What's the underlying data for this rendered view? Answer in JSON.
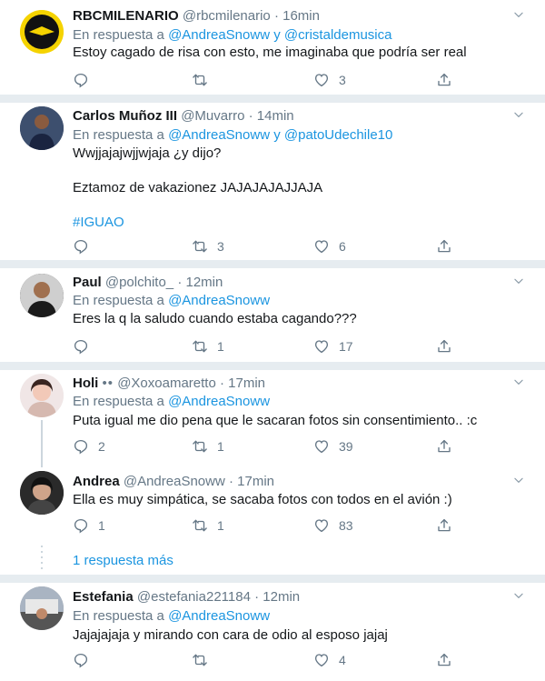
{
  "reply_prefix": "En respuesta a",
  "and_word": "y",
  "dot": "·",
  "tweets": [
    {
      "name": "RBCMILENARIO",
      "handle": "@rbcmilenario",
      "time": "16min",
      "mentions": [
        "@AndreaSnoww",
        "@cristaldemusica"
      ],
      "lines": [
        "Estoy cagado de risa con esto, me imaginaba que podría ser real"
      ],
      "replies": "",
      "retweets": "",
      "likes": "3"
    },
    {
      "name": "Carlos Muñoz III",
      "handle": "@Muvarro",
      "time": "14min",
      "mentions": [
        "@AndreaSnoww",
        "@patoUdechile10"
      ],
      "lines": [
        "Wwjjajajwjjwjaja ¿y dijo?",
        "Eztamoz de vakazionez JAJAJAJAJJAJA",
        "#IGUAO"
      ],
      "replies": "",
      "retweets": "3",
      "likes": "6"
    },
    {
      "name": "Paul",
      "handle": "@polchito_",
      "time": "12min",
      "mentions": [
        "@AndreaSnoww"
      ],
      "lines": [
        "Eres la q la saludo cuando estaba cagando???"
      ],
      "replies": "",
      "retweets": "1",
      "likes": "17"
    },
    {
      "name": "Holi",
      "name_emoji": "••",
      "handle": "@Xoxoamaretto",
      "time": "17min",
      "mentions": [
        "@AndreaSnoww"
      ],
      "lines": [
        "Puta igual me dio pena que le sacaran fotos sin consentimiento.. :c"
      ],
      "replies": "2",
      "retweets": "1",
      "likes": "39"
    },
    {
      "name": "Andrea",
      "handle": "@AndreaSnoww",
      "time": "17min",
      "mentions": [],
      "lines": [
        "Ella es muy simpática, se sacaba fotos con todos en el avión :)"
      ],
      "replies": "1",
      "retweets": "1",
      "likes": "83"
    },
    {
      "name": "Estefania",
      "handle": "@estefania221184",
      "time": "12min",
      "mentions": [
        "@AndreaSnoww"
      ],
      "lines": [
        "Jajajajaja y mirando con cara de odio al esposo jajaj"
      ],
      "replies": "",
      "retweets": "",
      "likes": "4"
    }
  ],
  "show_more": "1 respuesta más",
  "colors": {
    "link": "#1b95e0",
    "muted": "#657786",
    "separator": "#e6ecf0",
    "text": "#14171a"
  },
  "icons": [
    "reply-icon",
    "retweet-icon",
    "like-icon",
    "share-icon",
    "chevron-down-icon"
  ]
}
